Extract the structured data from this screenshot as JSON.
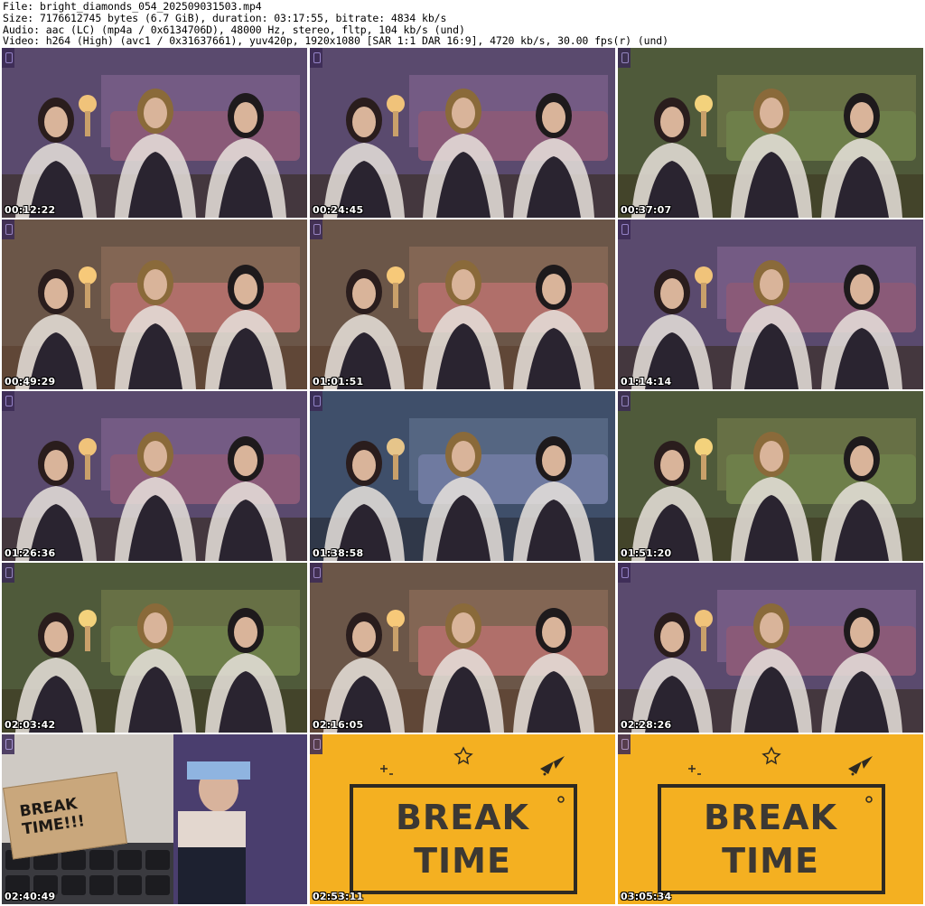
{
  "header": {
    "file_line": "File: bright_diamonds_054_202509031503.mp4",
    "size_line": "Size: 7176612745 bytes (6.7 GiB), duration: 03:17:55, bitrate: 4834 kb/s",
    "audio_line": "Audio: aac (LC) (mp4a / 0x6134706D), 48000 Hz, stereo, fltp, 104 kb/s (und)",
    "video_line": "Video: h264 (High) (avc1 / 0x31637661), yuv420p, 1920x1080 [SAR 1:1 DAR 16:9], 4720 kb/s, 30.00 fps(r) (und)"
  },
  "thumbnails": [
    {
      "timestamp": "00:12:22",
      "scene": "room-purple"
    },
    {
      "timestamp": "00:24:45",
      "scene": "room-purple"
    },
    {
      "timestamp": "00:37:07",
      "scene": "room-green"
    },
    {
      "timestamp": "00:49:29",
      "scene": "room-warm"
    },
    {
      "timestamp": "01:01:51",
      "scene": "room-warm"
    },
    {
      "timestamp": "01:14:14",
      "scene": "room-purple"
    },
    {
      "timestamp": "01:26:36",
      "scene": "room-purple"
    },
    {
      "timestamp": "01:38:58",
      "scene": "room-blue"
    },
    {
      "timestamp": "01:51:20",
      "scene": "room-green"
    },
    {
      "timestamp": "02:03:42",
      "scene": "room-green"
    },
    {
      "timestamp": "02:16:05",
      "scene": "room-warm"
    },
    {
      "timestamp": "02:28:26",
      "scene": "room-purple"
    },
    {
      "timestamp": "02:40:49",
      "scene": "break-card",
      "card_text": "BREAK TIME!!!"
    },
    {
      "timestamp": "02:53:11",
      "scene": "break-screen",
      "line1": "BREAK",
      "line2": "TIME"
    },
    {
      "timestamp": "03:05:34",
      "scene": "break-screen",
      "line1": "BREAK",
      "line2": "TIME"
    }
  ],
  "colors": {
    "break_yellow": "#f4b021",
    "break_text": "#3c3833",
    "timestamp_text": "#ffffff"
  }
}
